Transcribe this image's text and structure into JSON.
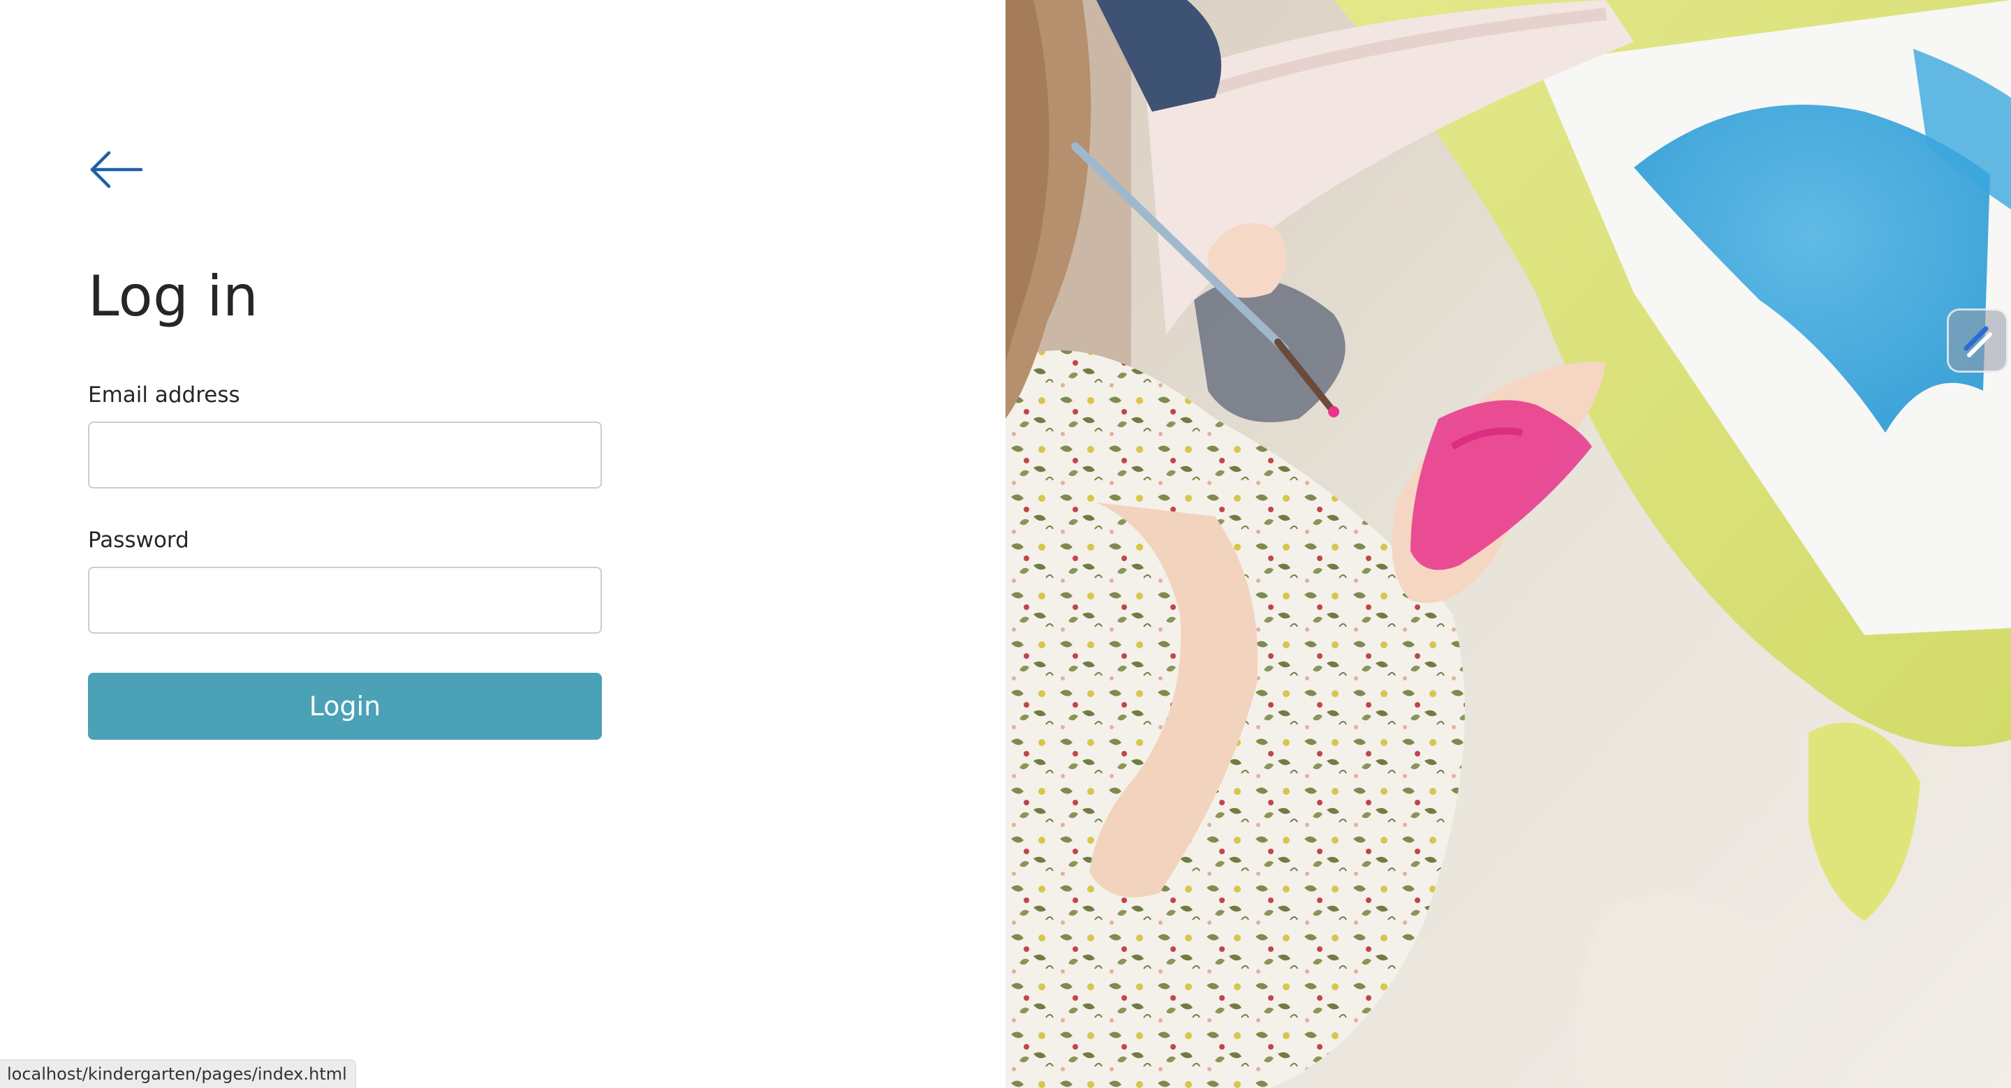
{
  "page": {
    "title": "Log in"
  },
  "form": {
    "email_label": "Email address",
    "email_value": "",
    "password_label": "Password",
    "password_value": "",
    "submit_label": "Login"
  },
  "icons": {
    "back": "arrow-left-icon",
    "extension": "extension-icon"
  },
  "colors": {
    "accent": "#4ba1b6",
    "back_arrow": "#1f5fa8",
    "title_text": "#262626"
  },
  "status_bar": {
    "url": "localhost/kindergarten/pages/index.html"
  }
}
